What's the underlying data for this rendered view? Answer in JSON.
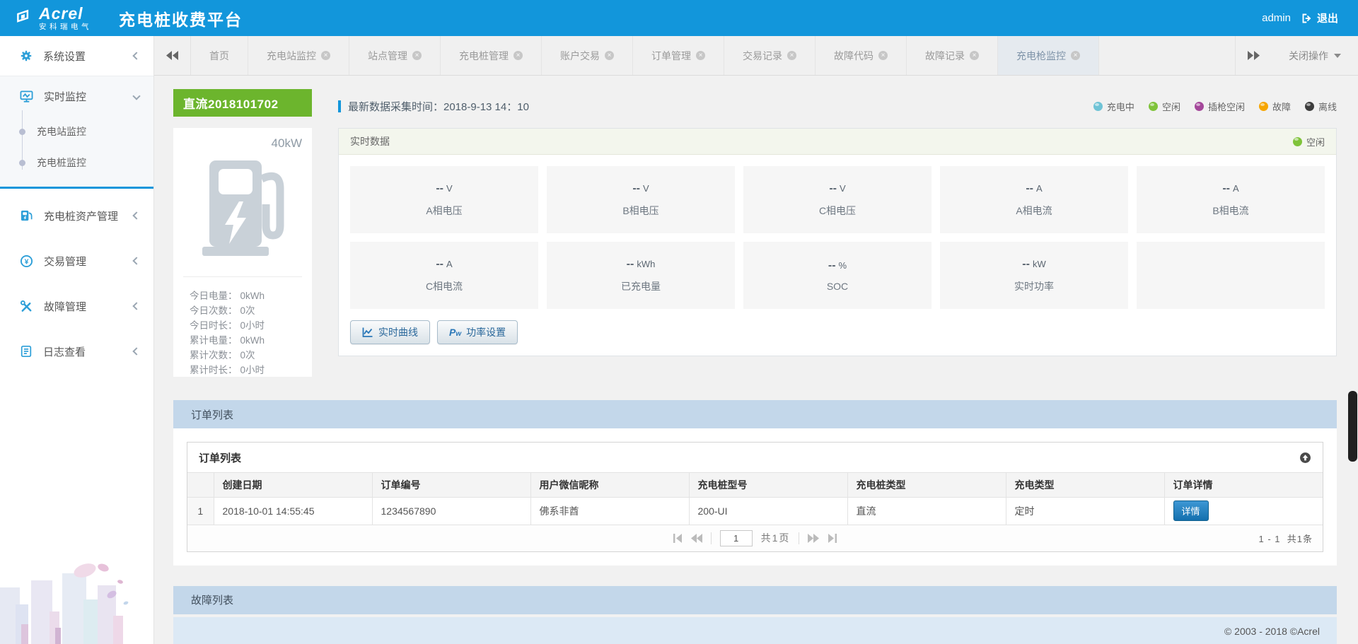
{
  "header": {
    "logo_text": "Acrel",
    "logo_sub": "安科瑞电气",
    "title": "充电桩收费平台",
    "user": "admin",
    "logout_label": "退出"
  },
  "tabbar": {
    "tabs": [
      {
        "label": "首页"
      },
      {
        "label": "充电站监控"
      },
      {
        "label": "站点管理"
      },
      {
        "label": "充电桩管理"
      },
      {
        "label": "账户交易"
      },
      {
        "label": "订单管理"
      },
      {
        "label": "交易记录"
      },
      {
        "label": "故障代码"
      },
      {
        "label": "故障记录"
      },
      {
        "label": "充电枪监控"
      }
    ],
    "close_ops_label": "关闭操作"
  },
  "sidebar": {
    "items": [
      {
        "label": "系统设置",
        "icon": "gear-icon"
      },
      {
        "label": "实时监控",
        "icon": "monitor-icon"
      },
      {
        "label": "充电桩资产管理",
        "icon": "charger-icon"
      },
      {
        "label": "交易管理",
        "icon": "transaction-icon"
      },
      {
        "label": "故障管理",
        "icon": "fault-icon"
      },
      {
        "label": "日志查看",
        "icon": "log-icon"
      }
    ],
    "realtime_children": [
      {
        "label": "充电站监控"
      },
      {
        "label": "充电桩监控"
      }
    ]
  },
  "pile": {
    "name": "直流2018101702",
    "power": "40kW",
    "stats": [
      {
        "label": "今日电量：",
        "value": "0kWh"
      },
      {
        "label": "今日次数：",
        "value": "0次"
      },
      {
        "label": "今日时长：",
        "value": "0小时"
      },
      {
        "label": "累计电量：",
        "value": "0kWh"
      },
      {
        "label": "累计次数：",
        "value": "0次"
      },
      {
        "label": "累计时长：",
        "value": "0小时"
      }
    ]
  },
  "monitor": {
    "collect_time": "最新数据采集时间：2018-9-13 14：10",
    "legend": [
      {
        "label": "充电中",
        "color": "#6fc3d6"
      },
      {
        "label": "空闲",
        "color": "#7fc33a"
      },
      {
        "label": "插枪空闲",
        "color": "#a4479a"
      },
      {
        "label": "故障",
        "color": "#f6a500"
      },
      {
        "label": "离线",
        "color": "#3c3c3c"
      }
    ],
    "panel_title": "实时数据",
    "status": {
      "label": "空闲",
      "color": "#7fc33a"
    },
    "metrics": [
      {
        "value": "--",
        "unit": "V",
        "label": "A相电压"
      },
      {
        "value": "--",
        "unit": "V",
        "label": "B相电压"
      },
      {
        "value": "--",
        "unit": "V",
        "label": "C相电压"
      },
      {
        "value": "--",
        "unit": "A",
        "label": "A相电流"
      },
      {
        "value": "--",
        "unit": "A",
        "label": "B相电流"
      },
      {
        "value": "--",
        "unit": "A",
        "label": "C相电流"
      },
      {
        "value": "--",
        "unit": "kWh",
        "label": "已充电量"
      },
      {
        "value": "--",
        "unit": "%",
        "label": "SOC"
      },
      {
        "value": "--",
        "unit": "kW",
        "label": "实时功率"
      }
    ],
    "buttons": [
      {
        "label": "实时曲线"
      },
      {
        "label": "功率设置"
      }
    ]
  },
  "orders": {
    "section_title": "订单列表",
    "panel_title": "订单列表",
    "columns": [
      "创建日期",
      "订单编号",
      "用户微信昵称",
      "充电桩型号",
      "充电桩类型",
      "充电类型",
      "订单详情"
    ],
    "rows": [
      {
        "index": "1",
        "values": [
          "2018-10-01 14:55:45",
          "1234567890",
          "佛系非酋",
          "200-UI",
          "直流",
          "定时"
        ],
        "action": "详情"
      }
    ],
    "pagination": {
      "page": "1",
      "total_pages": "共1页",
      "range": "1 - 1",
      "total": "共1条"
    }
  },
  "faults": {
    "section_title": "故障列表"
  },
  "footer": {
    "copyright": "© 2003 - 2018 ©Acrel"
  }
}
